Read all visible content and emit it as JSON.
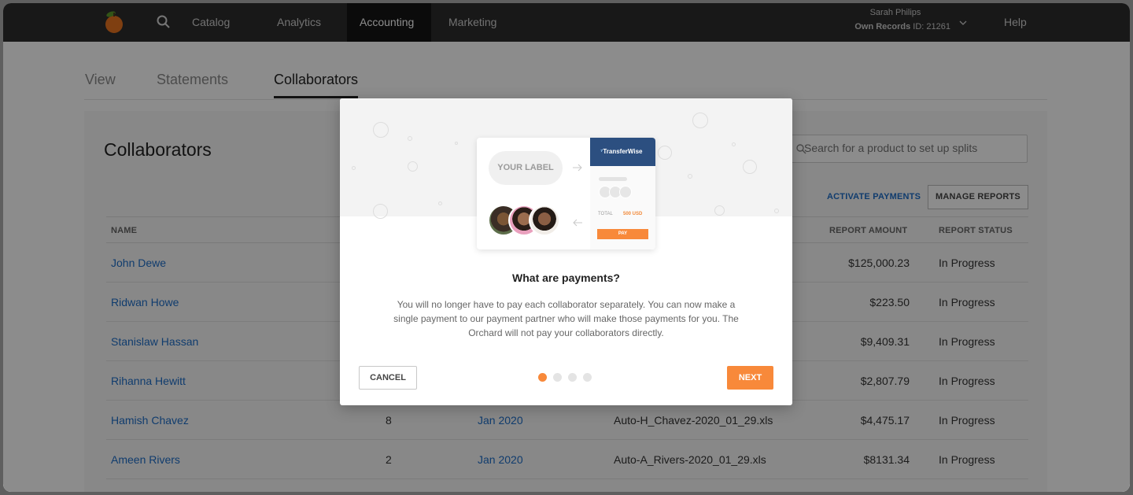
{
  "nav": {
    "items": [
      "Catalog",
      "Analytics",
      "Accounting",
      "Marketing"
    ],
    "active": "Accounting",
    "user_name": "Sarah Philips",
    "records_label": "Own Records",
    "records_id": "ID: 21261",
    "help": "Help",
    "icons": {
      "logo": "orange-logo",
      "search": "search-icon",
      "chevron": "chevron-down-icon"
    }
  },
  "tabs": [
    "View",
    "Statements",
    "Collaborators"
  ],
  "active_tab": "Collaborators",
  "panel": {
    "title": "Collaborators",
    "search_placeholder": "Search for a product to set up splits",
    "activate_payments": "ACTIVATE PAYMENTS",
    "manage_reports": "MANAGE REPORTS"
  },
  "table": {
    "headers": {
      "name": "NAME",
      "amount": "REPORT AMOUNT",
      "status": "REPORT STATUS"
    },
    "rows": [
      {
        "name": "John Dewe",
        "count": "",
        "period": "",
        "file": "",
        "amount": "$125,000.23",
        "status": "In Progress"
      },
      {
        "name": "Ridwan Howe",
        "count": "",
        "period": "",
        "file": "",
        "amount": "$223.50",
        "status": "In Progress"
      },
      {
        "name": "Stanislaw Hassan",
        "count": "",
        "period": "",
        "file": "",
        "amount": "$9,409.31",
        "status": "In Progress"
      },
      {
        "name": "Rihanna Hewitt",
        "count": "",
        "period": "",
        "file": "",
        "amount": "$2,807.79",
        "status": "In Progress"
      },
      {
        "name": "Hamish Chavez",
        "count": "8",
        "period": "Jan 2020",
        "file": "Auto-H_Chavez-2020_01_29.xls",
        "amount": "$4,475.17",
        "status": "In Progress"
      },
      {
        "name": "Ameen Rivers",
        "count": "2",
        "period": "Jan 2020",
        "file": "Auto-A_Rivers-2020_01_29.xls",
        "amount": "$8131.34",
        "status": "In Progress"
      }
    ]
  },
  "modal": {
    "illustration": {
      "your_label": "YOUR LABEL",
      "brand": "TransferWise",
      "total_label": "TOTAL",
      "total_amount": "500 USD",
      "pay_label": "PAY"
    },
    "title": "What are payments?",
    "body": "You will no longer have to pay each collaborator separately. You can now make a single payment to our payment partner who will make those payments for you. The Orchard will not pay your collaborators directly.",
    "cancel": "CANCEL",
    "next": "NEXT",
    "step_count": 4,
    "active_step": 1,
    "accent_color": "#f8893a"
  },
  "colors": {
    "nav_bg": "#2d2d2d",
    "link": "#1e6ec8",
    "accent": "#f8893a"
  }
}
